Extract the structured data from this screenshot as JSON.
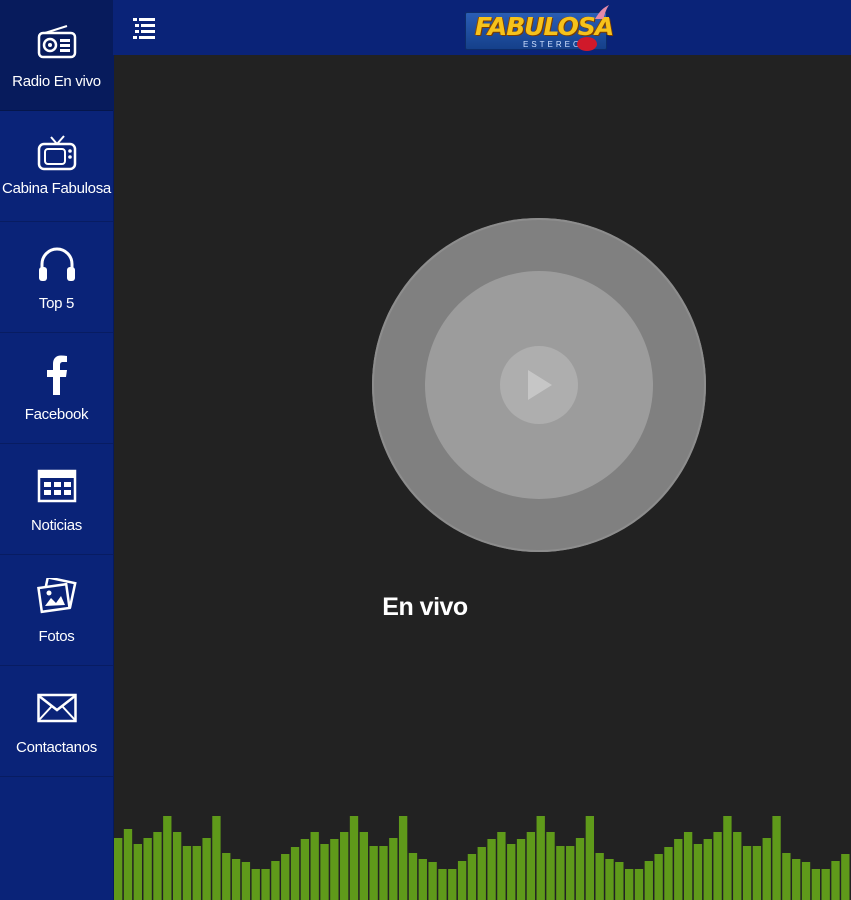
{
  "topbar": {
    "menu_icon": "hamburger-list-icon",
    "logo_text": "FABULOSA",
    "logo_sub": "ESTEREO"
  },
  "sidebar": {
    "items": [
      {
        "label": "Radio En vivo",
        "icon": "radio-icon",
        "active": true
      },
      {
        "label": "Cabina Fabulosa",
        "icon": "tv-icon",
        "active": false
      },
      {
        "label": "Top 5",
        "icon": "headphones-icon",
        "active": false
      },
      {
        "label": "Facebook",
        "icon": "facebook-icon",
        "active": false
      },
      {
        "label": "Noticias",
        "icon": "newspaper-icon",
        "active": false
      },
      {
        "label": "Fotos",
        "icon": "photos-icon",
        "active": false
      },
      {
        "label": "Contactanos",
        "icon": "envelope-icon",
        "active": false
      }
    ]
  },
  "player": {
    "status": "En vivo",
    "play_icon": "play-icon"
  },
  "visualizer": {
    "color": "#5f9a1a",
    "levels": [
      0.69,
      0.79,
      0.62,
      0.69,
      0.76,
      0.93,
      0.76,
      0.6,
      0.6,
      0.69,
      0.93,
      0.52,
      0.45,
      0.42,
      0.34,
      0.34,
      0.43,
      0.51,
      0.59,
      0.68,
      0.76,
      0.62,
      0.68,
      0.76,
      0.93,
      0.76,
      0.6,
      0.6,
      0.69,
      0.93,
      0.52,
      0.45,
      0.42,
      0.34,
      0.34,
      0.43,
      0.51,
      0.59,
      0.68,
      0.76,
      0.62,
      0.68,
      0.76,
      0.93,
      0.76,
      0.6,
      0.6,
      0.69,
      0.93,
      0.52,
      0.45,
      0.42,
      0.34,
      0.34,
      0.43,
      0.51,
      0.59,
      0.68,
      0.76,
      0.62,
      0.68,
      0.76,
      0.93,
      0.76,
      0.6,
      0.6,
      0.69,
      0.93,
      0.52,
      0.45,
      0.42,
      0.34,
      0.34,
      0.43,
      0.51
    ]
  },
  "colors": {
    "sidebar_bg": "#0a2378",
    "active_bg": "#071b5c",
    "main_bg": "#222222"
  }
}
